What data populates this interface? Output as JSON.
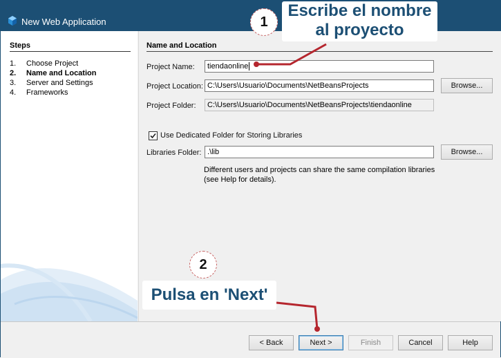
{
  "window": {
    "title": "New Web Application",
    "accent_color": "#1c4f74",
    "icon": "netbeans-cube-icon"
  },
  "steps": {
    "heading": "Steps",
    "items": [
      {
        "num": "1.",
        "label": "Choose Project",
        "active": false
      },
      {
        "num": "2.",
        "label": "Name and Location",
        "active": true
      },
      {
        "num": "3.",
        "label": "Server and Settings",
        "active": false
      },
      {
        "num": "4.",
        "label": "Frameworks",
        "active": false
      }
    ]
  },
  "form": {
    "section_title": "Name and Location",
    "project_name": {
      "label": "Project Name:",
      "value": "tiendaonline"
    },
    "project_location": {
      "label": "Project Location:",
      "value": "C:\\Users\\Usuario\\Documents\\NetBeansProjects",
      "browse_label": "Browse..."
    },
    "project_folder": {
      "label": "Project Folder:",
      "value": "C:\\Users\\Usuario\\Documents\\NetBeansProjects\\tiendaonline"
    },
    "dedicated_folder": {
      "label": "Use Dedicated Folder for Storing Libraries",
      "checked": true
    },
    "libraries_folder": {
      "label": "Libraries Folder:",
      "value": ".\\lib",
      "browse_label": "Browse..."
    },
    "help_line1": "Different users and projects can share the same compilation libraries",
    "help_line2": "(see Help for details)."
  },
  "buttons": {
    "back": "< Back",
    "next": "Next >",
    "finish": "Finish",
    "cancel": "Cancel",
    "help": "Help"
  },
  "annotations": {
    "badge1": "1",
    "callout1_line1": "Escribe el nombre",
    "callout1_line2": "al proyecto",
    "badge2": "2",
    "callout2": "Pulsa en 'Next'",
    "arrow_color": "#b5262e"
  }
}
